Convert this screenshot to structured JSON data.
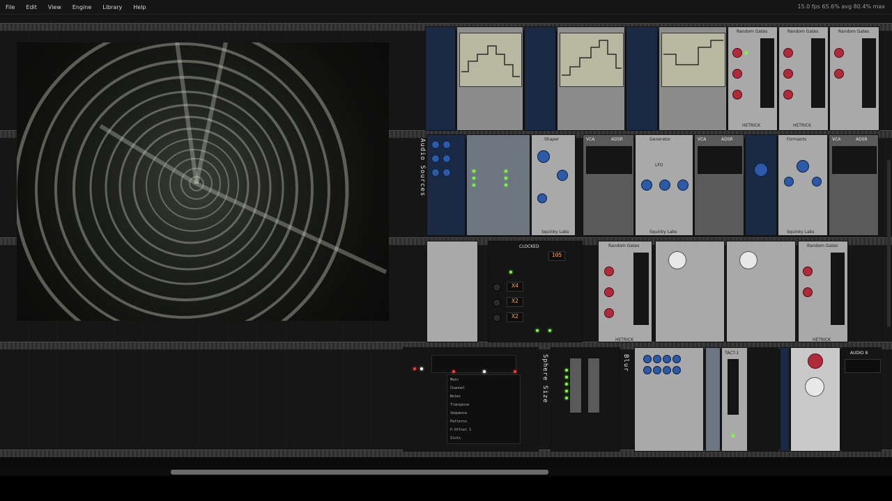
{
  "menu": {
    "items": [
      "File",
      "Edit",
      "View",
      "Engine",
      "Library",
      "Help"
    ]
  },
  "status": {
    "text": "15.0 fps  65.6% avg  80.4% max"
  },
  "labels": {
    "audio_sources": "Audio Sources",
    "sphere_size": "Sphere Size",
    "blur": "Blur",
    "random_gates": "Random Gates",
    "shaper": "Shaper",
    "generator": "Generator",
    "formants": "Formants",
    "vca": "VCA",
    "adsr": "ADSR",
    "lfo": "LFO",
    "audio": "AUDIO 8",
    "hetrick": "HETRICK",
    "squinky": "Squinky Labs",
    "clocked": "CLOCKED",
    "tact": "TACT-1"
  },
  "lcd": {
    "bpm": "105",
    "ratio1": "X4",
    "ratio2": "X2",
    "ratio3": "X2"
  },
  "sequencer_rows": [
    "Main",
    "Channel",
    "Notes",
    "Transpose",
    "Sequence",
    "Patterns",
    "P-Offset 1",
    "Slots"
  ],
  "colors": {
    "accent_led": "#7cff3a",
    "knob_blue": "#2a5aa8",
    "knob_red": "#b02a3a",
    "lcd_amber": "#ffae2a"
  }
}
